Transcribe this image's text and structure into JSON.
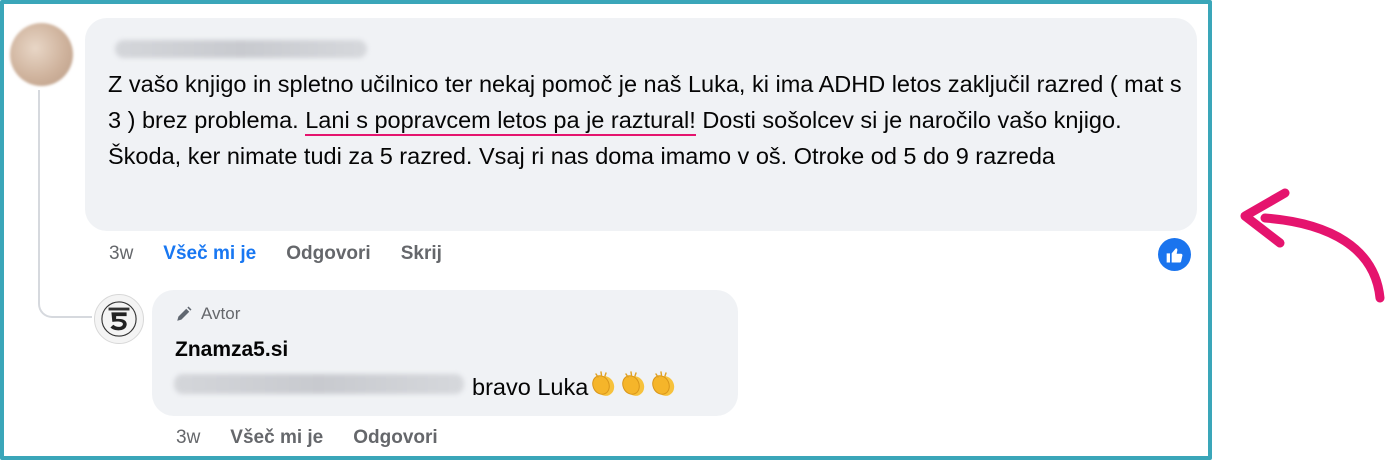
{
  "comment": {
    "text_before": "Z vašo knjigo in spletno učilnico ter nekaj pomoč je naš Luka, ki ima ADHD letos zaključil razred ( mat s 3 ) brez problema. ",
    "text_highlight": "Lani s popravcem letos pa je raztural!",
    "text_after": " Dosti sošolcev si je naročilo vašo knjigo. Škoda, ker nimate tudi za 5 razred. Vsaj ri nas doma imamo v oš. Otroke od 5 do 9 razreda",
    "time": "3w",
    "like_label": "Všeč mi je",
    "reply_label": "Odgovori",
    "hide_label": "Skrij",
    "like_color": "#1877f2"
  },
  "reply": {
    "badge": "Avtor",
    "author": "Znamza5.si",
    "text": "bravo Luka",
    "emoji": [
      "clapping-hands",
      "clapping-hands",
      "clapping-hands"
    ],
    "time": "3w",
    "like_label": "Všeč mi je",
    "reply_label": "Odgovori"
  },
  "colors": {
    "frame": "#3aa6b9",
    "highlight_underline": "#e5146e",
    "arrow": "#e5146e",
    "bubble": "#f0f2f5"
  }
}
